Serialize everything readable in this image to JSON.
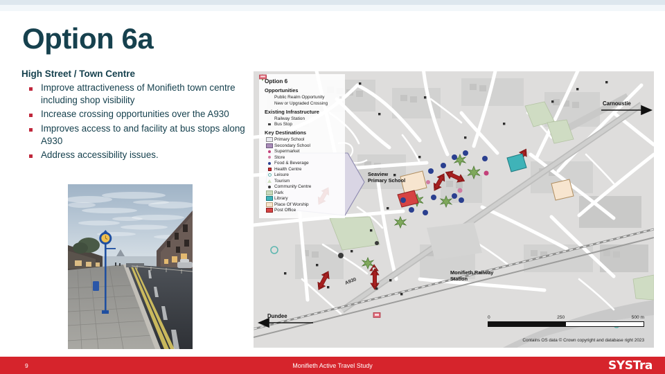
{
  "slide": {
    "title": "Option 6a",
    "subtitle": "High Street / Town Centre",
    "bullets": [
      "Improve attractiveness of Monifieth town centre including shop visibility",
      "Increase crossing opportunities over the A930",
      "Improves access to and facility at bus stops along A930",
      "Address accessibility issues."
    ]
  },
  "photo": {
    "alt": "Monifieth High Street at dusk with blue clock pole and paved footway"
  },
  "map": {
    "legend": {
      "title": "Option 6",
      "sections": [
        {
          "heading": "Opportunities",
          "items": [
            {
              "label": "Public Realm Opportunity",
              "icon": "green-starburst-icon",
              "color": "#6aa84f"
            },
            {
              "label": "New or Upgraded Crossing",
              "icon": "red-double-arrow-icon",
              "color": "#a02020"
            }
          ]
        },
        {
          "heading": "Existing Infrastructure",
          "items": [
            {
              "label": "Railway Station",
              "icon": "railway-station-icon",
              "color": "#e06a7a"
            },
            {
              "label": "Bus Stop",
              "icon": "bus-stop-dot-icon",
              "color": "#444444"
            }
          ]
        },
        {
          "heading": "Key Destinations",
          "items": [
            {
              "label": "Primary School",
              "icon": "swatch-icon",
              "color": "#e9e9ef"
            },
            {
              "label": "Secondary School",
              "icon": "swatch-icon",
              "color": "#a98cb8"
            },
            {
              "label": "Supermarket",
              "icon": "dot-icon",
              "color": "#c3407a"
            },
            {
              "label": "Store",
              "icon": "dot-icon",
              "color": "#d07aa0"
            },
            {
              "label": "Food & Beverage",
              "icon": "dot-icon",
              "color": "#2a3f8f"
            },
            {
              "label": "Health Centre",
              "icon": "square-marker-icon",
              "color": "#d03030"
            },
            {
              "label": "Leisure",
              "icon": "circle-outline-icon",
              "color": "#5fb7b0"
            },
            {
              "label": "Tourism",
              "icon": "triangle-icon",
              "color": "#cfe0c0"
            },
            {
              "label": "Community Centre",
              "icon": "dot-icon",
              "color": "#3a3a3a"
            },
            {
              "label": "Park",
              "icon": "swatch-icon",
              "color": "#c9d8bd"
            },
            {
              "label": "Library",
              "icon": "swatch-icon",
              "color": "#3fb3b8"
            },
            {
              "label": "Place Of Worship",
              "icon": "swatch-icon",
              "color": "#f7e5cf"
            },
            {
              "label": "Post Office",
              "icon": "swatch-icon",
              "color": "#d64343"
            }
          ]
        }
      ]
    },
    "labels": {
      "seaview_school": "Seaview\nPrimary School",
      "seaview_school_l1": "Seaview",
      "seaview_school_l2": "Primary School",
      "railway_station_l1": "Monifieth Railway",
      "railway_station_l2": "Station",
      "road_a930": "A930",
      "direction_east": "Carnoustie",
      "direction_west": "Dundee"
    },
    "scale": {
      "min": "0",
      "mid": "250",
      "max": "500 m"
    },
    "attribution": "Contains OS data © Crown copyright and database right 2023"
  },
  "footer": {
    "page_number": "9",
    "title": "Monifieth Active Travel Study",
    "logo": "SYSTra"
  }
}
